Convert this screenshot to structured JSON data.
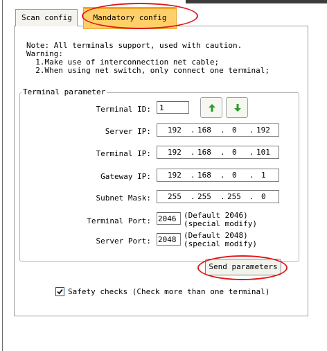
{
  "tabs": [
    {
      "label": "Scan config",
      "active": false
    },
    {
      "label": "Mandatory config",
      "active": true
    }
  ],
  "note": {
    "line1": "Note: All terminals support, used with caution.",
    "line2": "Warning:",
    "line3": "  1.Make use of interconnection net cable;",
    "line4": "  2.When using net switch, only connect one terminal;"
  },
  "group": {
    "title": "Terminal parameter",
    "terminal_id": {
      "label": "Terminal ID:",
      "value": "1"
    },
    "server_ip": {
      "label": "Server IP:",
      "octets": [
        "192",
        "168",
        "0",
        "192"
      ]
    },
    "terminal_ip": {
      "label": "Terminal IP:",
      "octets": [
        "192",
        "168",
        "0",
        "101"
      ]
    },
    "gateway_ip": {
      "label": "Gateway IP:",
      "octets": [
        "192",
        "168",
        "0",
        "1"
      ]
    },
    "subnet_mask": {
      "label": "Subnet Mask:",
      "octets": [
        "255",
        "255",
        "255",
        "0"
      ]
    },
    "terminal_port": {
      "label": "Terminal Port:",
      "value": "2046",
      "note1": "(Default 2046)",
      "note2": "(special modify)"
    },
    "server_port": {
      "label": "Server Port:",
      "value": "2048",
      "note1": "(Default 2048)",
      "note2": "(special modify)"
    },
    "send_label": "Send parameters"
  },
  "safety": {
    "label": "Safety checks (Check more than one terminal)",
    "checked": true
  },
  "icons": {
    "up": "arrow-up-icon",
    "down": "arrow-down-icon",
    "check": "checkmark-icon"
  },
  "colors": {
    "accent_tab": "#ffd06a",
    "highlight": "#e01818",
    "arrow_green": "#2c9a2c"
  }
}
